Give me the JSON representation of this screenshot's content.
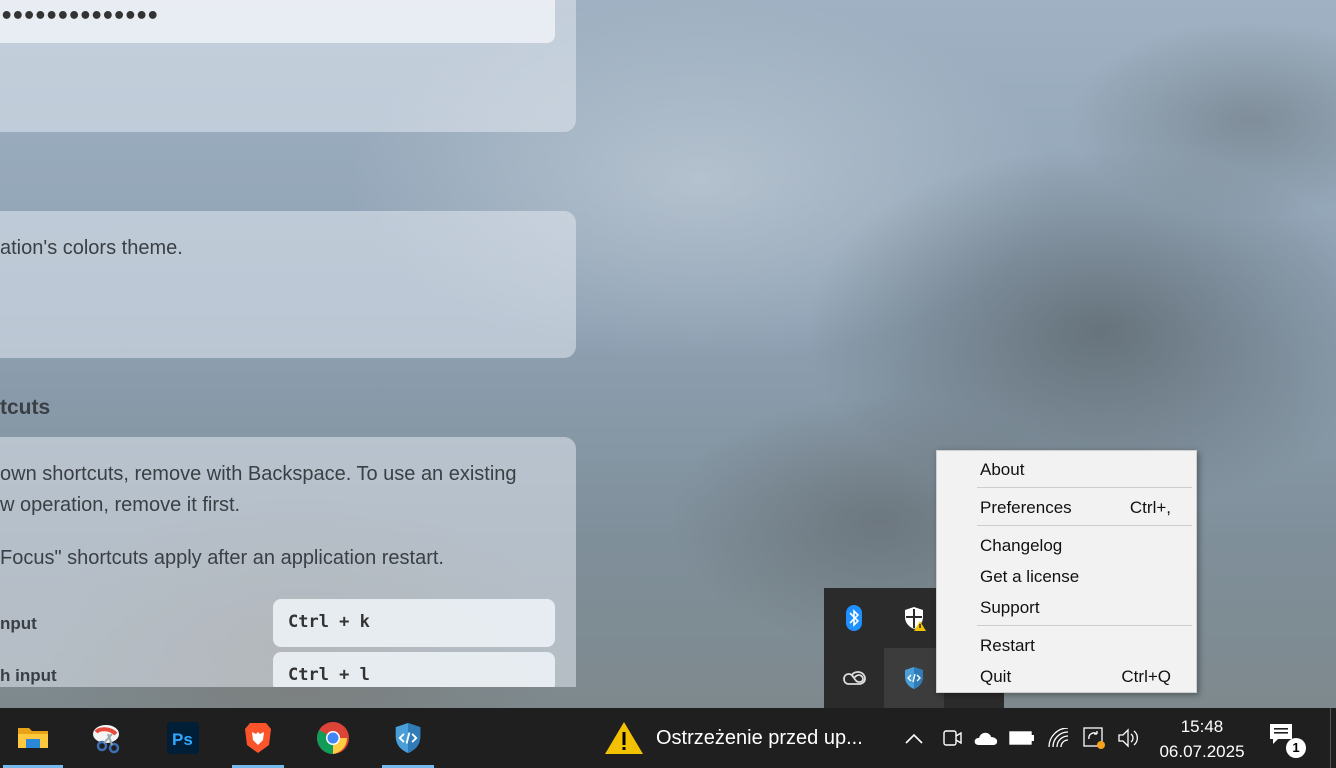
{
  "settings": {
    "password_value": "••••••••••••••",
    "theme_description": "ation's colors theme.",
    "shortcuts_section_title": "tcuts",
    "shortcuts_desc_line1": "own shortcuts, remove with Backspace. To use an existing",
    "shortcuts_desc_line2": "w operation, remove it first.",
    "shortcuts_desc_line3": "Focus\" shortcuts apply after an application restart.",
    "shortcuts": [
      {
        "label": "nput",
        "keys": "Ctrl + k"
      },
      {
        "label": "h input",
        "keys": "Ctrl + l"
      }
    ]
  },
  "tray_flyout": {
    "icons": [
      "bluetooth-icon",
      "windows-security-warning-icon",
      "creative-cloud-icon",
      "app-shield-code-icon"
    ]
  },
  "context_menu": {
    "items": [
      {
        "label": "About",
        "shortcut": ""
      },
      {
        "label": "Preferences",
        "shortcut": "Ctrl+,"
      },
      {
        "label": "Changelog",
        "shortcut": ""
      },
      {
        "label": "Get a license",
        "shortcut": ""
      },
      {
        "label": "Support",
        "shortcut": ""
      },
      {
        "label": "Restart",
        "shortcut": ""
      },
      {
        "label": "Quit",
        "shortcut": "Ctrl+Q"
      }
    ]
  },
  "taskbar": {
    "apps": [
      "file-explorer-icon",
      "snipping-tool-icon",
      "photoshop-icon",
      "brave-browser-icon",
      "chrome-icon",
      "app-shield-code-icon"
    ],
    "warning_text": "Ostrzeżenie przed up...",
    "time": "15:48",
    "date": "06.07.2025",
    "notification_count": "1",
    "accent_color": "#76b9ed"
  }
}
